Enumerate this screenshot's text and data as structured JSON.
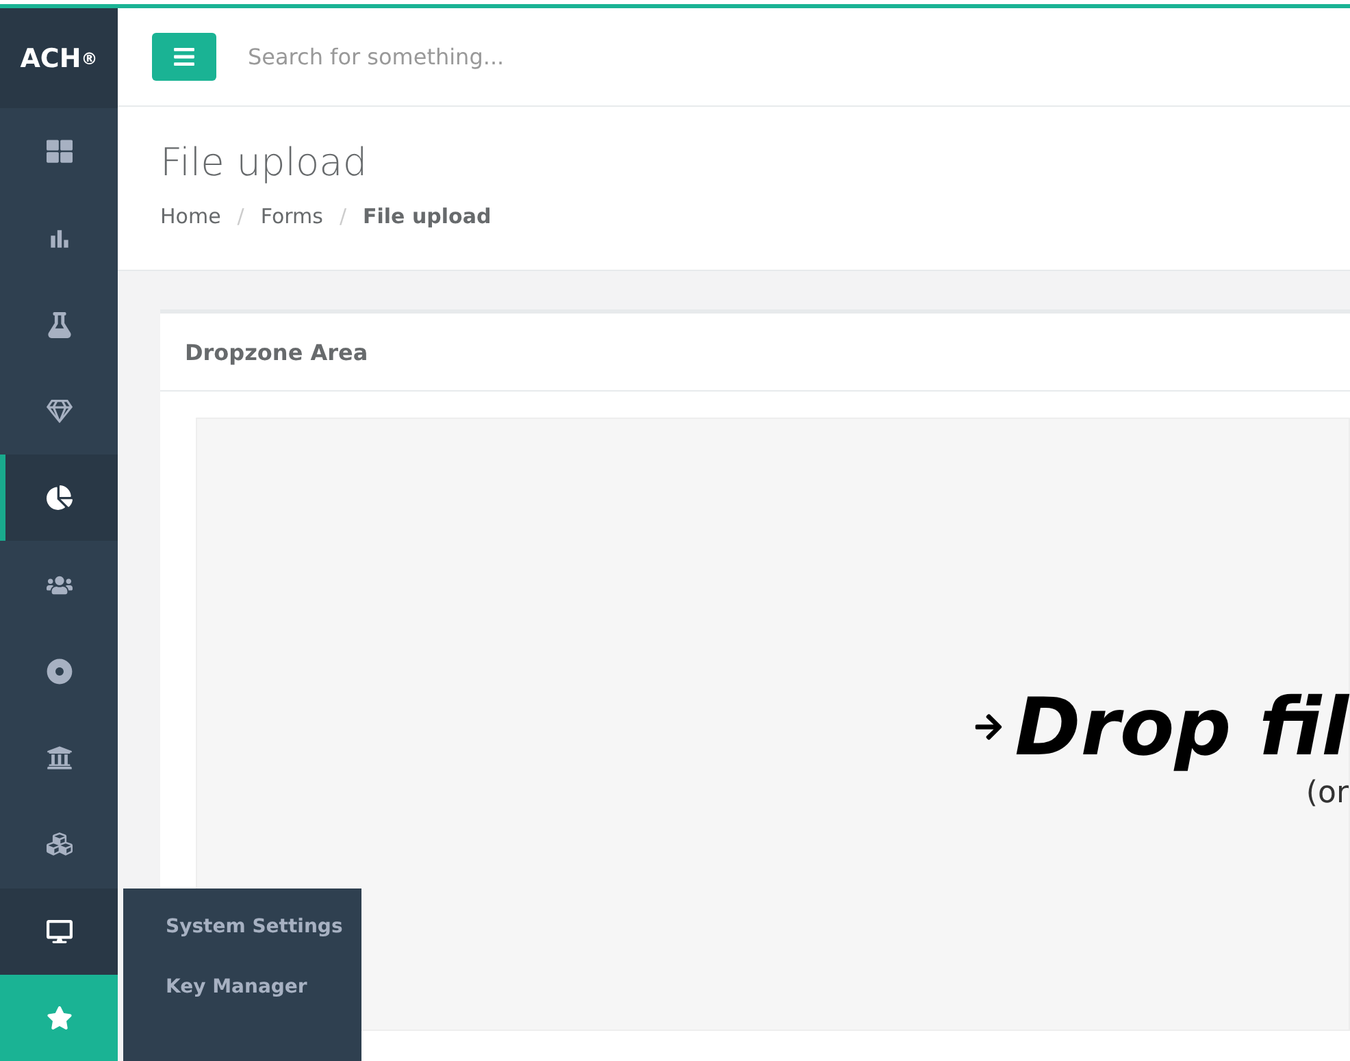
{
  "brand": {
    "name": "ACH",
    "mark": "®"
  },
  "sidebar": {
    "items": [
      {
        "selected": false,
        "expanded": false,
        "highlighted": false
      },
      {
        "selected": false,
        "expanded": false,
        "highlighted": false
      },
      {
        "selected": false,
        "expanded": false,
        "highlighted": false
      },
      {
        "selected": false,
        "expanded": false,
        "highlighted": false
      },
      {
        "selected": true,
        "expanded": false,
        "highlighted": false
      },
      {
        "selected": false,
        "expanded": false,
        "highlighted": false
      },
      {
        "selected": false,
        "expanded": false,
        "highlighted": false
      },
      {
        "selected": false,
        "expanded": false,
        "highlighted": false
      },
      {
        "selected": false,
        "expanded": false,
        "highlighted": false
      },
      {
        "selected": false,
        "expanded": true,
        "highlighted": false
      },
      {
        "selected": false,
        "expanded": false,
        "highlighted": true
      }
    ]
  },
  "flyout_menu": {
    "items": [
      "System Settings",
      "Key Manager"
    ]
  },
  "search": {
    "placeholder": "Search for something..."
  },
  "page": {
    "title": "File upload",
    "breadcrumb_separator": "/",
    "breadcrumb": [
      {
        "label": "Home",
        "current": false
      },
      {
        "label": "Forms",
        "current": false
      },
      {
        "label": "File upload",
        "current": true
      }
    ]
  },
  "panel": {
    "title": "Dropzone Area",
    "dropzone": {
      "headline": "Drop fil",
      "subline": "(or"
    }
  }
}
